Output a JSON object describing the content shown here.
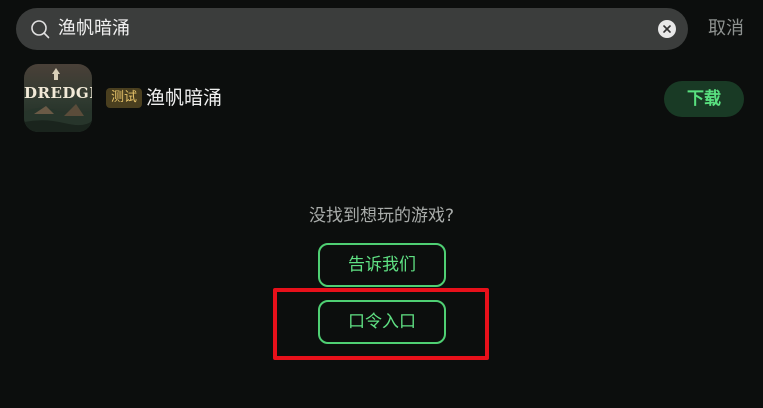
{
  "search": {
    "value": "渔帆暗涌",
    "cancel_label": "取消"
  },
  "result": {
    "icon_text": "DREDGE",
    "badge": "测试",
    "title": "渔帆暗涌",
    "download_label": "下载"
  },
  "empty_state": {
    "message": "没找到想玩的游戏?",
    "tell_us_label": "告诉我们",
    "code_entry_label": "口令入口"
  },
  "colors": {
    "accent": "#5fe083",
    "highlight": "#e8101a",
    "background": "#0c0e0d"
  }
}
